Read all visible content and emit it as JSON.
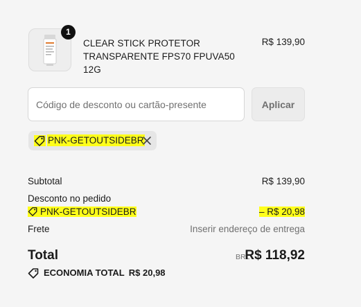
{
  "product": {
    "quantity": "1",
    "title": "CLEAR STICK PROTETOR TRANSPARENTE FPS70 FPUVA50 12G",
    "price": "R$ 139,90",
    "image_icon": "product-tube-icon"
  },
  "discount": {
    "placeholder": "Código de desconto ou cartão-presente",
    "value": "",
    "apply_label": "Aplicar",
    "applied_code": "PNK-GETOUTSIDEBR"
  },
  "summary": {
    "subtotal_label": "Subtotal",
    "subtotal_value": "R$ 139,90",
    "order_discount_label": "Desconto no pedido",
    "order_discount_code": "PNK-GETOUTSIDEBR",
    "order_discount_value": "– R$ 20,98",
    "shipping_label": "Frete",
    "shipping_value": "Inserir endereço de entrega",
    "total_label": "Total",
    "currency": "BRL",
    "total_value": "R$ 118,92",
    "savings_label": "ECONOMIA TOTAL",
    "savings_value": "R$ 20,98"
  },
  "colors": {
    "highlight": "#ffff1a",
    "text": "#1a1a1a",
    "muted": "#707070",
    "background": "#f5f5f5"
  }
}
